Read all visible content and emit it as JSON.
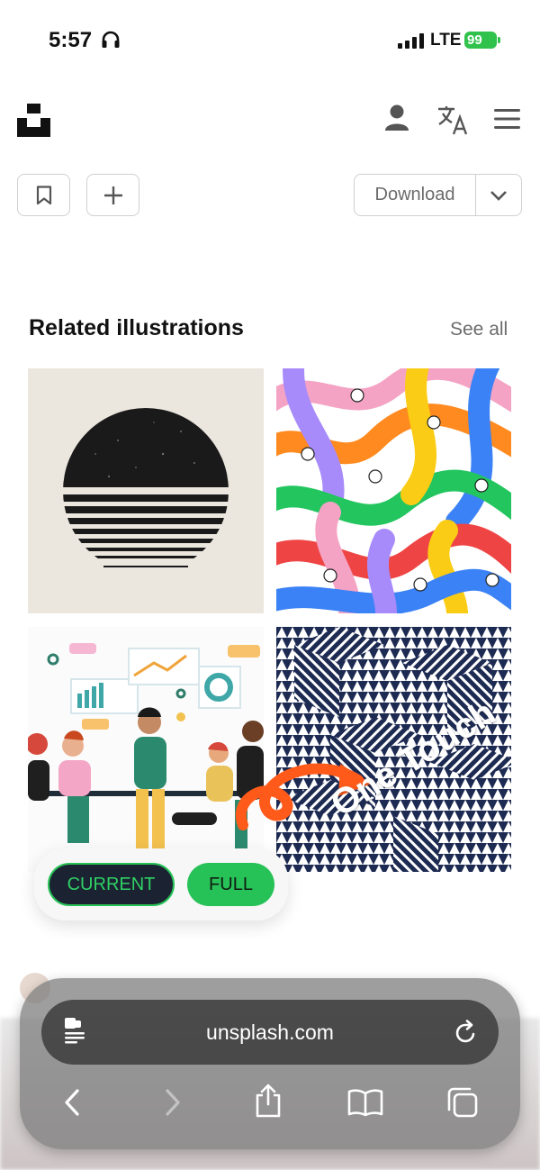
{
  "status_bar": {
    "time": "5:57",
    "network": "LTE",
    "battery": "99"
  },
  "header": {
    "icons": [
      "unsplash-logo",
      "user-icon",
      "translate-icon",
      "menu-icon"
    ]
  },
  "actions": {
    "download_label": "Download",
    "icons": [
      "bookmark-icon",
      "plus-icon",
      "chevron-down-icon"
    ]
  },
  "related": {
    "title": "Related illustrations",
    "see_all": "See all",
    "overlay_text": "One Touch"
  },
  "mode_toggle": {
    "current_label": "CURRENT",
    "full_label": "FULL"
  },
  "browser": {
    "url": "unsplash.com",
    "icons": [
      "page-menu-icon",
      "reload-icon",
      "back-icon",
      "forward-icon",
      "share-icon",
      "bookmarks-icon",
      "tabs-icon"
    ]
  }
}
